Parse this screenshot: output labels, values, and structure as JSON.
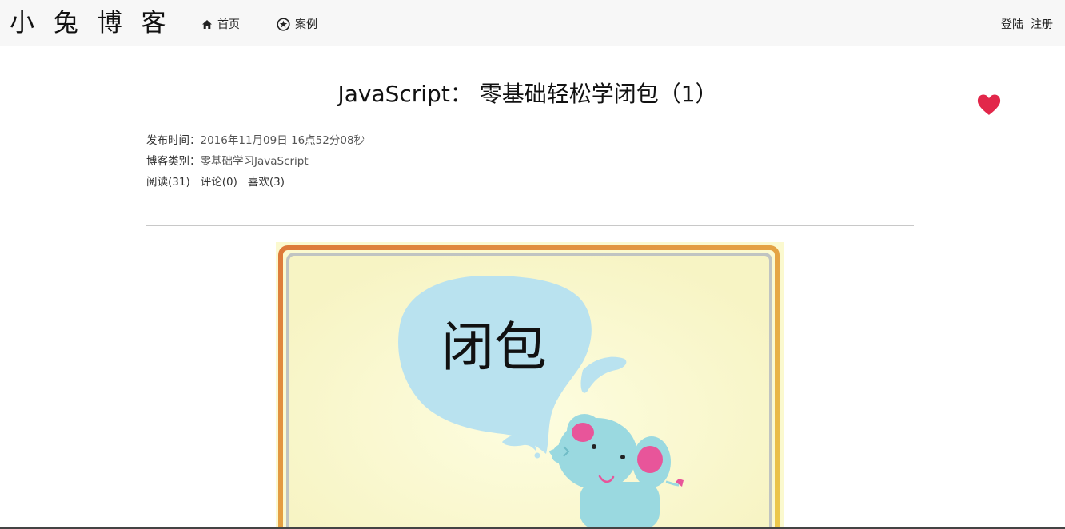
{
  "header": {
    "brand": "小 兔 博 客",
    "nav": [
      {
        "label": "首页",
        "icon": "home-icon"
      },
      {
        "label": "案例",
        "icon": "star-circle-icon"
      }
    ],
    "login_label": "登陆",
    "register_label": "注册"
  },
  "article": {
    "title": "JavaScript： 零基础轻松学闭包（1）",
    "publish_label": "发布时间：",
    "publish_time": "2016年11月09日 16点52分08秒",
    "category_label": "博客类别：",
    "category": "零基础学习JavaScript",
    "stats": {
      "reads": "阅读(31)",
      "comments": "评论(0)",
      "likes": "喜欢(3)"
    },
    "image_text": "闭包"
  },
  "colors": {
    "heart": "#e2274a",
    "navbar_bg": "#f7f7f7",
    "frame_orange": "#e08a3c",
    "frame_yellow": "#e8c24a",
    "poster_bg": "#fbf9cf",
    "bubble": "#b9e2ef",
    "elephant": "#9ad9e0",
    "ear_pink": "#e8559a"
  },
  "icons": {
    "favorite": "heart-icon"
  }
}
